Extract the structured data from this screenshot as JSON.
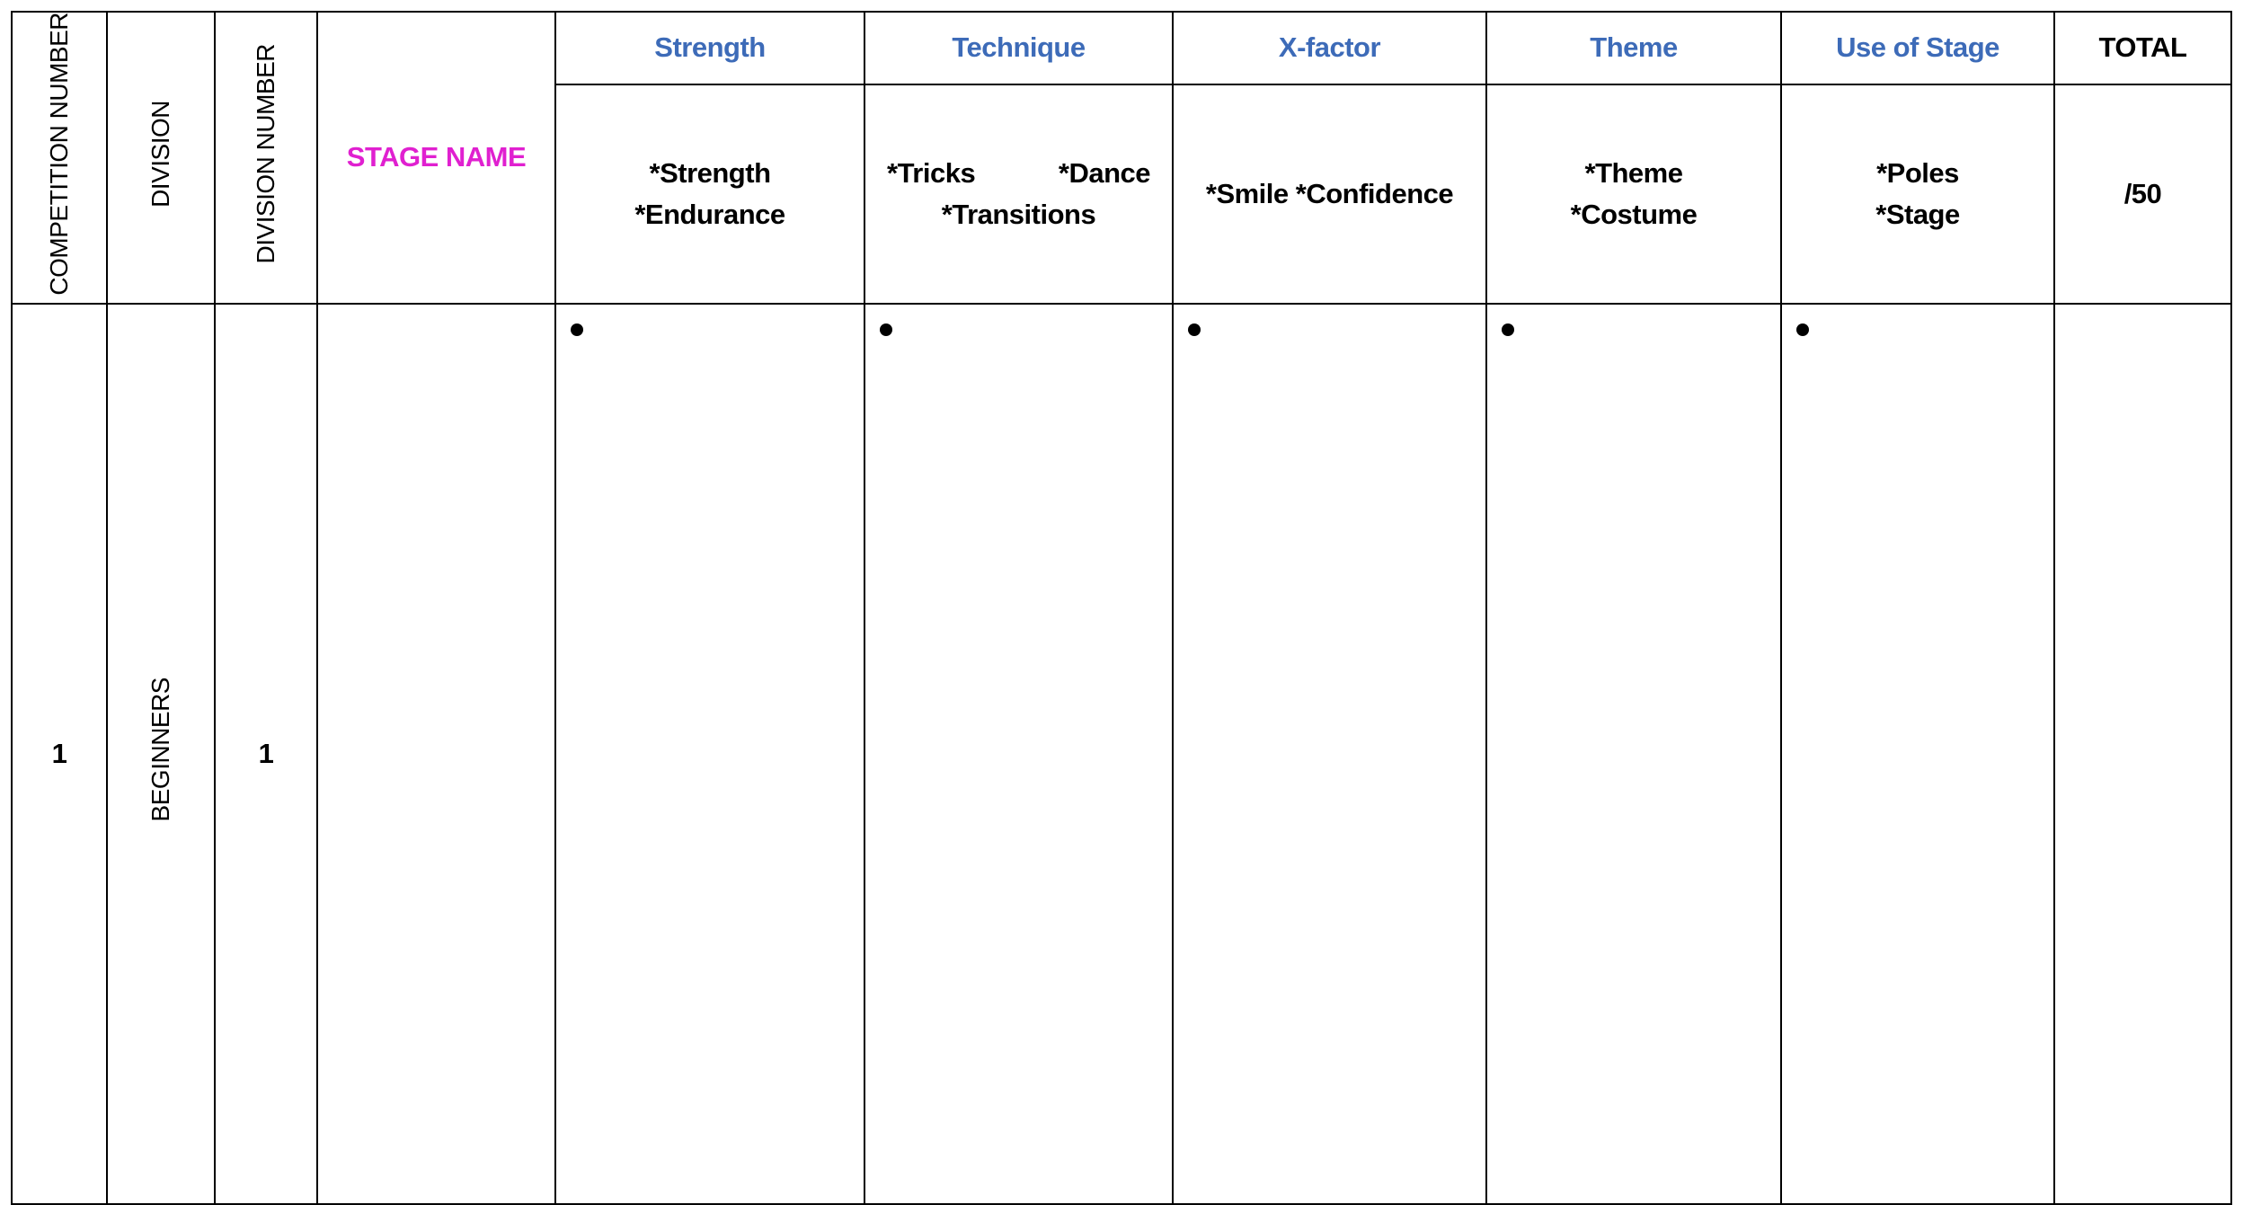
{
  "headers": {
    "competition_number": "COMPETITION NUMBER",
    "division": "DIVISION",
    "division_number": "DIVISION NUMBER",
    "stage_name": "STAGE NAME",
    "categories": [
      {
        "title": "Strength",
        "criteria": [
          "*Strength",
          "*Endurance"
        ]
      },
      {
        "title": "Technique",
        "criteria": [
          "*Tricks",
          "*Dance",
          "*Transitions"
        ]
      },
      {
        "title": "X-factor",
        "criteria": [
          "*Smile *Confidence"
        ]
      },
      {
        "title": "Theme",
        "criteria": [
          "*Theme",
          "*Costume"
        ]
      },
      {
        "title": "Use of Stage",
        "criteria": [
          "*Poles",
          "*Stage"
        ]
      }
    ],
    "total": "TOTAL",
    "total_max": "/50"
  },
  "rows": [
    {
      "competition_number": "1",
      "division": "BEGINNERS",
      "division_number": "1",
      "stage_name": ""
    }
  ],
  "colors": {
    "category": "#3d6bb8",
    "stage_name": "#e020d0"
  }
}
